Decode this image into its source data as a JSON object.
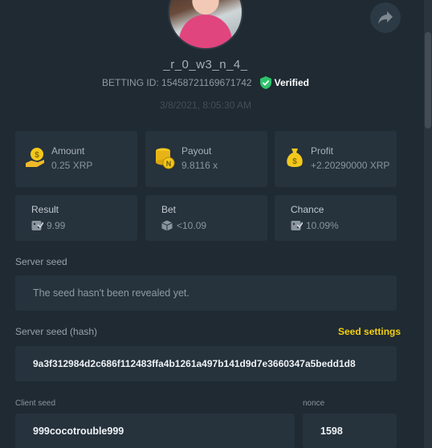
{
  "profile": {
    "username": "_r_0_w3_n_4_",
    "betting_id": "BETTING ID: 15458721169671742",
    "verified": "Verified",
    "datetime": "3/8/2021, 8:05:30 AM"
  },
  "stats": {
    "amount": {
      "label": "Amount",
      "value": "0.25 XRP",
      "icon": "coin-hand-icon"
    },
    "payout": {
      "label": "Payout",
      "value": "9.8116 x",
      "icon": "coin-stack-icon"
    },
    "profit": {
      "label": "Profit",
      "value": "+2.20290000 XRP",
      "icon": "money-bag-icon"
    }
  },
  "details": {
    "result": {
      "label": "Result",
      "value": "9.99",
      "icon": "dice-icon"
    },
    "bet": {
      "label": "Bet",
      "value": "<10.09",
      "icon": "cube-icon"
    },
    "chance": {
      "label": "Chance",
      "value": "10.09%",
      "icon": "dice-icon"
    }
  },
  "server_seed": {
    "label": "Server seed",
    "value": "The seed hasn't been revealed yet."
  },
  "server_seed_hash": {
    "label": "Server seed (hash)",
    "settings_link": "Seed settings",
    "value": "9a3f312984d2c686f112483ffa4b1261a497b141d9d7e3660347a5bedd1d8"
  },
  "client_seed": {
    "label": "Client seed",
    "value": "999cocotrouble999"
  },
  "nonce": {
    "label": "nonce",
    "value": "1598"
  },
  "colors": {
    "background": "#1f2a33",
    "card": "#26323c",
    "accent_yellow": "#f5d00d",
    "verified_green": "#2ec36b"
  }
}
